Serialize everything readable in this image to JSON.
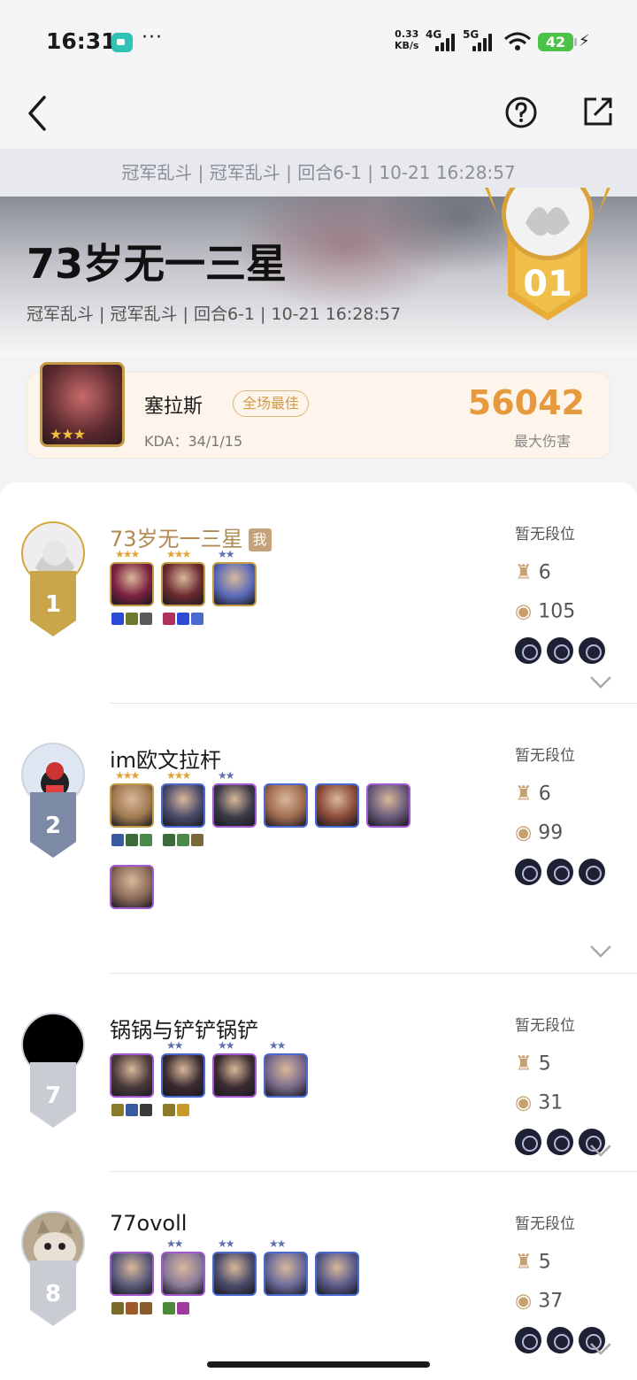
{
  "status_bar": {
    "time": "16:31",
    "dots": "···",
    "speed_value": "0.33",
    "speed_unit": "KB/s",
    "net1": "4G",
    "net2": "5G",
    "battery": "42"
  },
  "nav": {
    "back_icon": "chevron-left-icon",
    "help_icon": "question-circle-icon",
    "share_icon": "share-external-icon"
  },
  "subbar": "冠军乱斗 | 冠军乱斗 | 回合6-1 | 10-21 16:28:57",
  "hero": {
    "title": "73岁无一三星",
    "meta": "冠军乱斗 | 冠军乱斗 | 回合6-1 |  10-21 16:28:57",
    "rank_number": "01"
  },
  "mvp": {
    "champion": "塞拉斯",
    "tag": "全场最佳",
    "kda": "KDA：34/1/15",
    "damage": "56042",
    "damage_label": "最大伤害",
    "stars": "★★★"
  },
  "colors": {
    "gold": "#c9a64a",
    "silver": "#7d8aa6",
    "gray": "#c9ccd2",
    "orange": "#e69a3d"
  },
  "players": [
    {
      "name": "73岁无一三星",
      "me_tag": "我",
      "place": "1",
      "rank": "暂无段位",
      "level": "6",
      "gold": "105",
      "units": [
        {
          "stars": "★★★",
          "star_color": "#e3a23a",
          "border": "#c59b46",
          "color": "#7b2040",
          "items": [
            "#2b4bd6",
            "#6c7a2d",
            "#5a5a5a"
          ]
        },
        {
          "stars": "★★★",
          "star_color": "#e3a23a",
          "border": "#c59b46",
          "color": "#6b2a30",
          "items": [
            "#b03060",
            "#2b4bd6",
            "#4a6ad0"
          ]
        },
        {
          "stars": "★★",
          "star_color": "#6070b0",
          "border": "#c59b46",
          "color": "#5a6ab8",
          "items": []
        }
      ]
    },
    {
      "name": "im欧文拉杆",
      "me_tag": "",
      "place": "2",
      "rank": "暂无段位",
      "level": "6",
      "gold": "99",
      "units": [
        {
          "stars": "★★★",
          "star_color": "#e3a23a",
          "border": "#c59b46",
          "color": "#a07a50",
          "items": [
            "#3a5aa0",
            "#3b6a3b",
            "#4a8a4a"
          ]
        },
        {
          "stars": "★★★",
          "star_color": "#e3a23a",
          "border": "#4a6ad0",
          "color": "#4a4a6a",
          "items": [
            "#3b6a3b",
            "#4a8a4a",
            "#7a6a3a"
          ]
        },
        {
          "stars": "★★",
          "star_color": "#6070b0",
          "border": "#a35ad0",
          "color": "#3a3a48",
          "items": []
        },
        {
          "stars": "",
          "star_color": "#6070b0",
          "border": "#4a6ad0",
          "color": "#a06a50",
          "items": []
        },
        {
          "stars": "",
          "star_color": "#6070b0",
          "border": "#4a6ad0",
          "color": "#8a4a3a",
          "items": []
        },
        {
          "stars": "",
          "star_color": "#6070b0",
          "border": "#a35ad0",
          "color": "#6a5a7a",
          "items": []
        },
        {
          "stars": "",
          "star_color": "#6070b0",
          "border": "#a35ad0",
          "color": "#8a6a5a",
          "items": []
        }
      ]
    },
    {
      "name": "锅锅与铲铲锅铲",
      "me_tag": "",
      "place": "7",
      "rank": "暂无段位",
      "level": "5",
      "gold": "31",
      "units": [
        {
          "stars": "",
          "star_color": "#6070b0",
          "border": "#a35ad0",
          "color": "#4a3a3a",
          "items": [
            "#8a7a2a",
            "#3a5aa0",
            "#3a3a3a"
          ]
        },
        {
          "stars": "★★",
          "star_color": "#6070b0",
          "border": "#4a6ad0",
          "color": "#3a2a30",
          "items": [
            "#8a7a2a",
            "#c89a2a"
          ]
        },
        {
          "stars": "★★",
          "star_color": "#6070b0",
          "border": "#a35ad0",
          "color": "#3a2a30",
          "items": []
        },
        {
          "stars": "★★",
          "star_color": "#6070b0",
          "border": "#4a6ad0",
          "color": "#7a6a8a",
          "items": []
        }
      ]
    },
    {
      "name": "77ovoll",
      "me_tag": "",
      "place": "8",
      "rank": "暂无段位",
      "level": "5",
      "gold": "37",
      "units": [
        {
          "stars": "",
          "star_color": "#6070b0",
          "border": "#a35ad0",
          "color": "#5a5a7a",
          "items": [
            "#7a6a2a",
            "#a05a2a",
            "#8a5a2a"
          ]
        },
        {
          "stars": "★★",
          "star_color": "#6070b0",
          "border": "#a35ad0",
          "color": "#8a7a9a",
          "items": [
            "#4a8a3a",
            "#a03aa0"
          ]
        },
        {
          "stars": "★★",
          "star_color": "#6070b0",
          "border": "#4a6ad0",
          "color": "#4a4a6a",
          "items": []
        },
        {
          "stars": "★★",
          "star_color": "#6070b0",
          "border": "#4a6ad0",
          "color": "#6a6a9a",
          "items": []
        },
        {
          "stars": "",
          "star_color": "#6070b0",
          "border": "#4a6ad0",
          "color": "#5a5a8a",
          "items": []
        }
      ]
    }
  ]
}
